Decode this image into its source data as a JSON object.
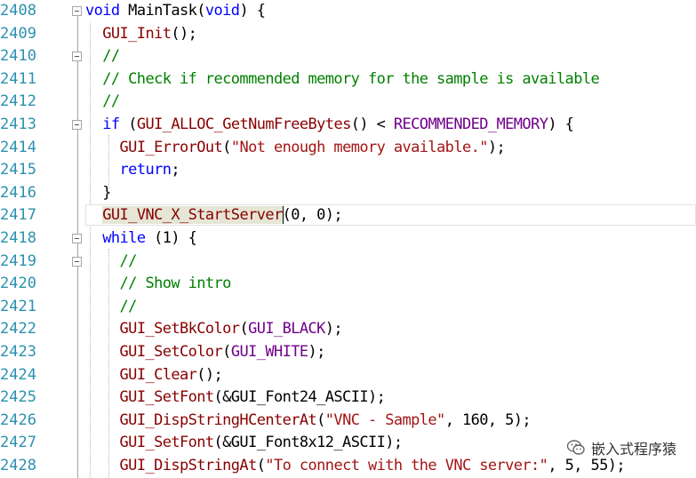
{
  "editor": {
    "line_numbers": [
      "2408",
      "2409",
      "2410",
      "2411",
      "2412",
      "2413",
      "2414",
      "2415",
      "2416",
      "2417",
      "2418",
      "2419",
      "2420",
      "2421",
      "2422",
      "2423",
      "2424",
      "2425",
      "2426",
      "2427",
      "2428"
    ],
    "lines": [
      [
        {
          "t": "void",
          "c": "kw"
        },
        {
          "t": " MainTask(",
          "c": ""
        },
        {
          "t": "void",
          "c": "kw"
        },
        {
          "t": ") {",
          "c": ""
        }
      ],
      [
        {
          "t": "  GUI_Init",
          "c": "fn"
        },
        {
          "t": "();",
          "c": ""
        }
      ],
      [
        {
          "t": "  //",
          "c": "cm"
        }
      ],
      [
        {
          "t": "  // Check if recommended memory for the sample is available",
          "c": "cm"
        }
      ],
      [
        {
          "t": "  //",
          "c": "cm"
        }
      ],
      [
        {
          "t": "  ",
          "c": ""
        },
        {
          "t": "if",
          "c": "kw"
        },
        {
          "t": " (",
          "c": ""
        },
        {
          "t": "GUI_ALLOC_GetNumFreeBytes",
          "c": "fn"
        },
        {
          "t": "() < ",
          "c": ""
        },
        {
          "t": "RECOMMENDED_MEMORY",
          "c": "mc"
        },
        {
          "t": ") {",
          "c": ""
        }
      ],
      [
        {
          "t": "    ",
          "c": ""
        },
        {
          "t": "GUI_ErrorOut",
          "c": "fn"
        },
        {
          "t": "(",
          "c": ""
        },
        {
          "t": "\"Not enough memory available.\"",
          "c": "st"
        },
        {
          "t": ");",
          "c": ""
        }
      ],
      [
        {
          "t": "    ",
          "c": ""
        },
        {
          "t": "return",
          "c": "kw"
        },
        {
          "t": ";",
          "c": ""
        }
      ],
      [
        {
          "t": "  }",
          "c": ""
        }
      ],
      [
        {
          "t": "  ",
          "c": ""
        },
        {
          "t": "GUI_VNC_X_StartServer",
          "c": "fn sel"
        },
        {
          "t": "|",
          "c": "caret"
        },
        {
          "t": "(0, 0);",
          "c": ""
        }
      ],
      [
        {
          "t": "  ",
          "c": ""
        },
        {
          "t": "while",
          "c": "kw"
        },
        {
          "t": " (1) {",
          "c": ""
        }
      ],
      [
        {
          "t": "    //",
          "c": "cm"
        }
      ],
      [
        {
          "t": "    // Show intro",
          "c": "cm"
        }
      ],
      [
        {
          "t": "    //",
          "c": "cm"
        }
      ],
      [
        {
          "t": "    ",
          "c": ""
        },
        {
          "t": "GUI_SetBkColor",
          "c": "fn"
        },
        {
          "t": "(",
          "c": ""
        },
        {
          "t": "GUI_BLACK",
          "c": "mc"
        },
        {
          "t": ");",
          "c": ""
        }
      ],
      [
        {
          "t": "    ",
          "c": ""
        },
        {
          "t": "GUI_SetColor",
          "c": "fn"
        },
        {
          "t": "(",
          "c": ""
        },
        {
          "t": "GUI_WHITE",
          "c": "mc"
        },
        {
          "t": ");",
          "c": ""
        }
      ],
      [
        {
          "t": "    ",
          "c": ""
        },
        {
          "t": "GUI_Clear",
          "c": "fn"
        },
        {
          "t": "();",
          "c": ""
        }
      ],
      [
        {
          "t": "    ",
          "c": ""
        },
        {
          "t": "GUI_SetFont",
          "c": "fn"
        },
        {
          "t": "(&GUI_Font24_ASCII);",
          "c": ""
        }
      ],
      [
        {
          "t": "    ",
          "c": ""
        },
        {
          "t": "GUI_DispStringHCenterAt",
          "c": "fn"
        },
        {
          "t": "(",
          "c": ""
        },
        {
          "t": "\"VNC - Sample\"",
          "c": "st"
        },
        {
          "t": ", 160, 5);",
          "c": ""
        }
      ],
      [
        {
          "t": "    ",
          "c": ""
        },
        {
          "t": "GUI_SetFont",
          "c": "fn"
        },
        {
          "t": "(&GUI_Font8x12_ASCII);",
          "c": ""
        }
      ],
      [
        {
          "t": "    ",
          "c": ""
        },
        {
          "t": "GUI_DispStringAt",
          "c": "fn"
        },
        {
          "t": "(",
          "c": ""
        },
        {
          "t": "\"To connect with the VNC server:\"",
          "c": "st"
        },
        {
          "t": ", 5, 55);",
          "c": ""
        }
      ]
    ],
    "fold_rows": [
      0,
      2,
      5,
      10,
      11
    ]
  },
  "watermark": {
    "text": "嵌入式程序猿",
    "icon": "wechat-icon"
  },
  "colors": {
    "keyword": "#0000ff",
    "comment": "#008000",
    "string": "#a31515",
    "macro": "#6f008a",
    "function": "#880000",
    "line_number": "#2b91af"
  }
}
